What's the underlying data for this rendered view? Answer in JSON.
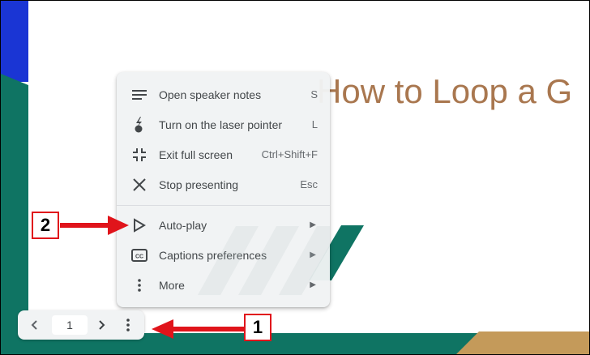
{
  "slide": {
    "title": "How to Loop a G"
  },
  "menu": {
    "items": [
      {
        "label": "Open speaker notes",
        "shortcut": "S",
        "icon": "notes-lines-icon"
      },
      {
        "label": "Turn on the laser pointer",
        "shortcut": "L",
        "icon": "laser-pointer-icon"
      },
      {
        "label": "Exit full screen",
        "shortcut": "Ctrl+Shift+F",
        "icon": "exit-fullscreen-icon"
      },
      {
        "label": "Stop presenting",
        "shortcut": "Esc",
        "icon": "close-icon"
      },
      {
        "label": "Auto-play",
        "shortcut": "",
        "icon": "play-outline-icon",
        "submenu_arrow": "▶"
      },
      {
        "label": "Captions preferences",
        "shortcut": "",
        "icon": "cc-icon",
        "submenu_arrow": "▶"
      },
      {
        "label": "More",
        "shortcut": "",
        "icon": "more-vert-icon",
        "submenu_arrow": "▶"
      }
    ]
  },
  "toolbar": {
    "prev_icon": "chevron-left-icon",
    "page_number": "1",
    "next_icon": "chevron-right-icon",
    "options_icon": "more-vert-icon"
  },
  "annotations": {
    "badge_1": "1",
    "badge_2": "2",
    "accent_color": "#e0141b"
  },
  "colors": {
    "slide_green": "#0f7463",
    "slide_blue": "#1a35d4",
    "slide_gold": "#c49a5a",
    "title_brown": "#a9774f"
  }
}
